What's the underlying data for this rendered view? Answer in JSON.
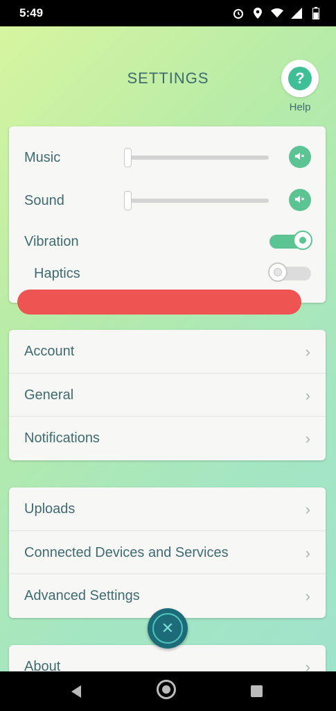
{
  "status": {
    "time": "5:49"
  },
  "header": {
    "title": "SETTINGS",
    "help_label": "Help",
    "help_glyph": "?"
  },
  "sound_card": {
    "music_label": "Music",
    "music_level": 0,
    "sound_label": "Sound",
    "sound_level": 0,
    "vibration_label": "Vibration",
    "vibration_on": true,
    "haptics_label": "Haptics",
    "haptics_on": false
  },
  "menu_group_1": [
    {
      "label": "Account"
    },
    {
      "label": "General"
    },
    {
      "label": "Notifications"
    }
  ],
  "menu_group_2": [
    {
      "label": "Uploads"
    },
    {
      "label": "Connected Devices and Services"
    },
    {
      "label": "Advanced Settings"
    }
  ],
  "menu_group_3": [
    {
      "label": "About"
    }
  ],
  "colors": {
    "accent": "#5cc492",
    "text": "#3f6b70",
    "close_button": "#1b6b79",
    "redaction": "#ee5451"
  },
  "icons": {
    "help": "question-icon",
    "mute": "speaker-muted-icon",
    "chevron": "chevron-right-icon",
    "close": "close-icon"
  }
}
